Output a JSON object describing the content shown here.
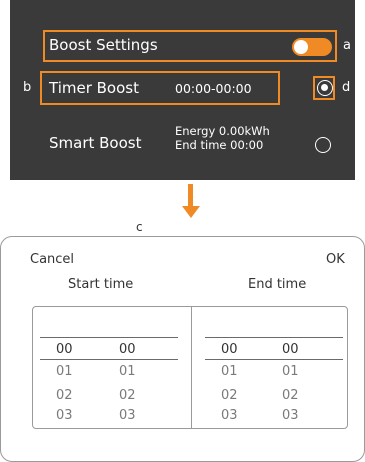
{
  "top_panel": {
    "boost_settings_label": "Boost Settings",
    "timer_boost_label": "Timer Boost",
    "timer_boost_value": "00:00-00:00",
    "smart_boost_label": "Smart Boost",
    "smart_boost_energy": "Energy 0.00kWh",
    "smart_boost_end_time": "End time 00:00",
    "annotations": {
      "a": "a",
      "b": "b",
      "c": "c",
      "d": "d"
    },
    "colors": {
      "panel_bg": "#3a3a3a",
      "accent": "#f08a24"
    }
  },
  "dialog": {
    "cancel_label": "Cancel",
    "ok_label": "OK",
    "start_time_label": "Start time",
    "end_time_label": "End time",
    "start_picker": {
      "hours_selected": "00",
      "hours_list": [
        "01",
        "02",
        "03"
      ],
      "minutes_selected": "00",
      "minutes_list": [
        "01",
        "02",
        "03"
      ]
    },
    "end_picker": {
      "hours_selected": "00",
      "hours_list": [
        "01",
        "02",
        "03"
      ],
      "minutes_selected": "00",
      "minutes_list": [
        "01",
        "02",
        "03"
      ]
    }
  }
}
